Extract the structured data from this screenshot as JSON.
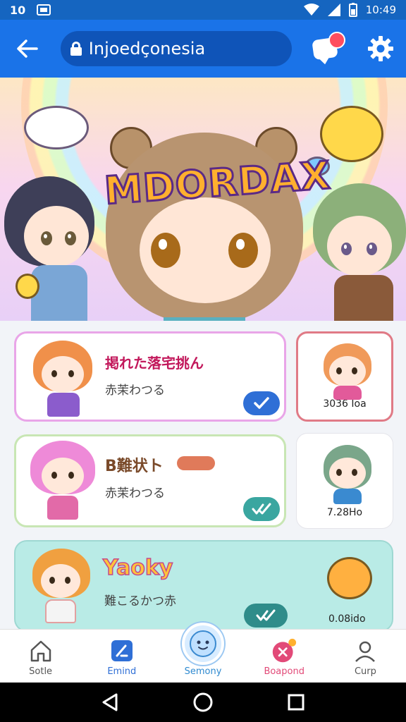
{
  "status_bar": {
    "time_left": "10",
    "time_right": "10:49"
  },
  "app_bar": {
    "url_text": "Injoedçonesia"
  },
  "banner": {
    "title": "MDORDAX"
  },
  "cards": [
    {
      "title": "掲れた落宅挑ん",
      "subtitle": "赤茉わつる",
      "side_label": "3036 Ioa"
    },
    {
      "title": "B難状ト",
      "subtitle": "赤茉わつる",
      "side_label": "7.28Ho"
    },
    {
      "title": "Yaoky",
      "subtitle": "難こるかつ赤",
      "side_label": "0.08ido"
    }
  ],
  "bottom_nav": [
    "Sotle",
    "Emind",
    "Semony",
    "Boapond",
    "Curp"
  ],
  "colors": {
    "appbar": "#1a73e8",
    "accent_blue": "#2f6fd6",
    "pink": "#e24a78",
    "teal": "#3aa6a0"
  }
}
